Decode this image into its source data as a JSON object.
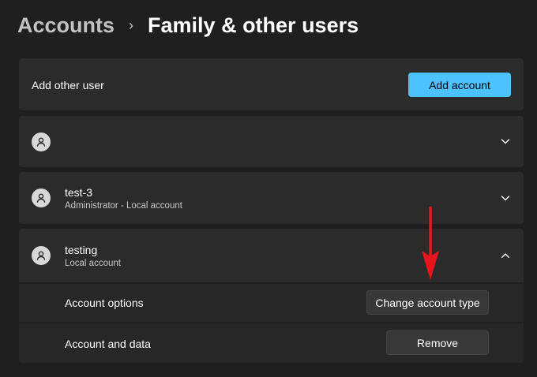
{
  "breadcrumb": {
    "parent": "Accounts",
    "separator": "›",
    "current": "Family & other users"
  },
  "add_user": {
    "label": "Add other user",
    "button": "Add account"
  },
  "users": [
    {
      "name": "",
      "subtitle": "",
      "expanded": false,
      "icon": "chevron-down-icon"
    },
    {
      "name": "test-3",
      "subtitle": "Administrator - Local account",
      "expanded": false,
      "icon": "chevron-down-icon"
    },
    {
      "name": "testing",
      "subtitle": "Local account",
      "expanded": true,
      "icon": "chevron-up-icon"
    }
  ],
  "expanded_user": {
    "account_options_label": "Account options",
    "change_type_button": "Change account type",
    "account_data_label": "Account and data",
    "remove_button": "Remove"
  },
  "colors": {
    "background": "#1f1f1f",
    "card": "#2b2b2b",
    "accent": "#4cc2ff",
    "annotation_arrow": "#e8141b"
  },
  "icons": [
    "person-icon",
    "chevron-down-icon",
    "chevron-up-icon",
    "annotation-arrow-icon"
  ]
}
